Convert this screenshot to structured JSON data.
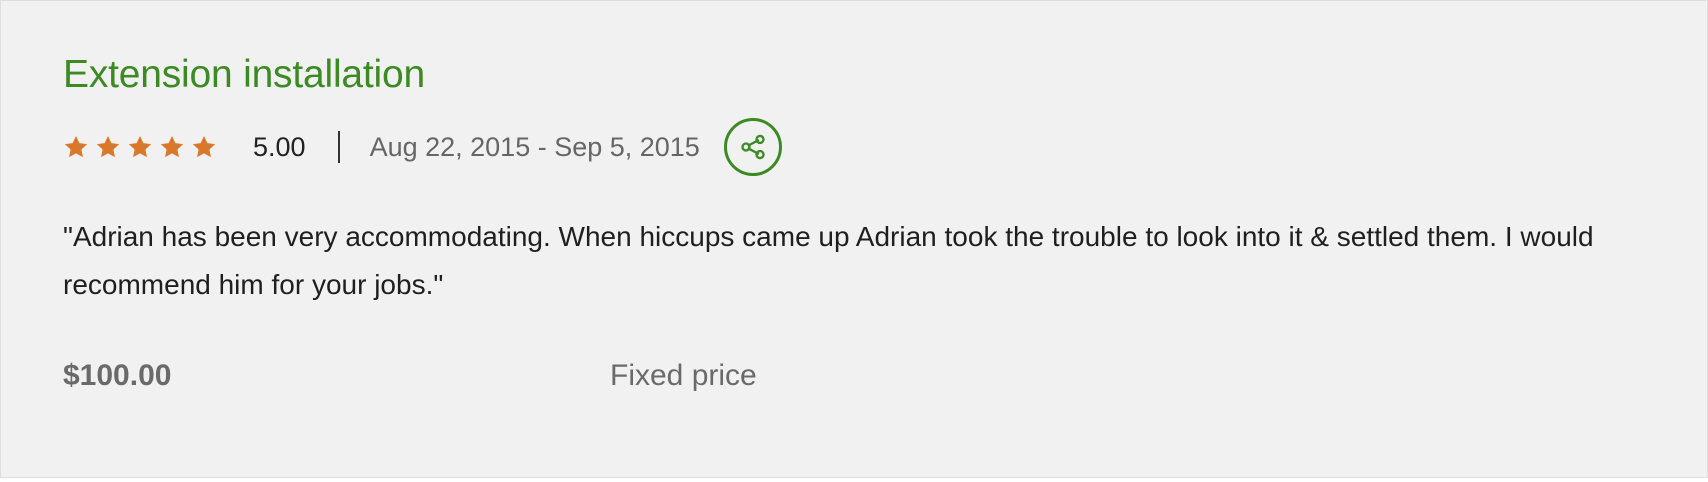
{
  "job": {
    "title": "Extension installation",
    "rating": {
      "stars": 5,
      "max_stars": 5,
      "score_text": "5.00",
      "star_color": "#d7782a",
      "star_icon": "star-icon"
    },
    "date_range": "Aug 22, 2015 - Sep 5, 2015",
    "share": {
      "icon": "share-icon",
      "color": "#3c8a23"
    },
    "review_text": "\"Adrian has been very accommodating. When hiccups came up Adrian took the trouble to look into it & settled them. I would recommend him for your jobs.\"",
    "price": "$100.00",
    "price_type": "Fixed price"
  },
  "theme": {
    "accent": "#3c8a23",
    "card_background": "#f1f1f1",
    "muted_text": "#666666"
  }
}
